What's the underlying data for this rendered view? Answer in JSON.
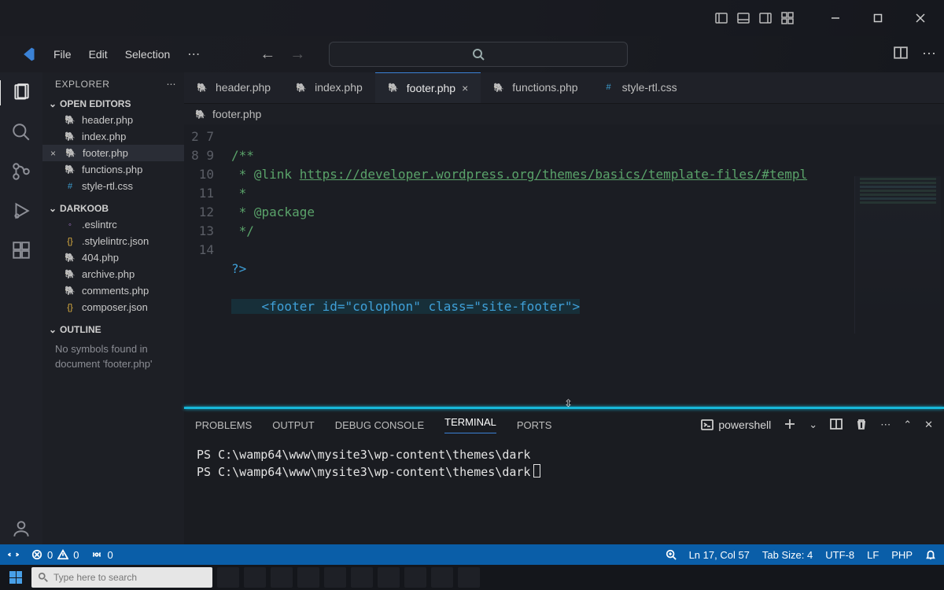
{
  "menu": {
    "file": "File",
    "edit": "Edit",
    "selection": "Selection"
  },
  "sidebar": {
    "title": "EXPLORER",
    "sections": {
      "openEditors": "OPEN EDITORS",
      "project": "DARKOOB",
      "outline": "OUTLINE"
    },
    "openEditors": [
      {
        "name": "header.php",
        "icon": "php"
      },
      {
        "name": "index.php",
        "icon": "php"
      },
      {
        "name": "footer.php",
        "icon": "php",
        "active": true
      },
      {
        "name": "functions.php",
        "icon": "php"
      },
      {
        "name": "style-rtl.css",
        "icon": "css"
      }
    ],
    "projectFiles": [
      {
        "name": ".eslintrc",
        "icon": "rc"
      },
      {
        "name": ".stylelintrc.json",
        "icon": "json"
      },
      {
        "name": "404.php",
        "icon": "php"
      },
      {
        "name": "archive.php",
        "icon": "php"
      },
      {
        "name": "comments.php",
        "icon": "php"
      },
      {
        "name": "composer.json",
        "icon": "json"
      }
    ],
    "outlineMsg": "No symbols found in document 'footer.php'"
  },
  "tabs": [
    {
      "name": "header.php",
      "icon": "php"
    },
    {
      "name": "index.php",
      "icon": "php"
    },
    {
      "name": "footer.php",
      "icon": "php",
      "active": true
    },
    {
      "name": "functions.php",
      "icon": "php"
    },
    {
      "name": "style-rtl.css",
      "icon": "css"
    }
  ],
  "breadcrumb": "footer.php",
  "gutter": [
    "2",
    "7",
    "8",
    "9",
    "10",
    "11",
    "12",
    "13",
    "14"
  ],
  "code": {
    "l0": "/**",
    "l1a": " * @link ",
    "l1b": "https://developer.wordpress.org/themes/basics/template-files/#templ",
    "l2": " *",
    "l3": " * @package",
    "l4": " */",
    "l5": "",
    "l6": "?>",
    "l7": "",
    "l8": "    <footer id=\"colophon\" class=\"site-footer\">"
  },
  "panel": {
    "tabs": {
      "problems": "PROBLEMS",
      "output": "OUTPUT",
      "debug": "DEBUG CONSOLE",
      "terminal": "TERMINAL",
      "ports": "PORTS"
    },
    "shell": "powershell",
    "lines": [
      "PS C:\\wamp64\\www\\mysite3\\wp-content\\themes\\dark",
      "PS C:\\wamp64\\www\\mysite3\\wp-content\\themes\\dark"
    ]
  },
  "status": {
    "errors": "0",
    "warnings": "0",
    "radio": "0",
    "pos": "Ln 17, Col 57",
    "spaces": "Tab Size: 4",
    "enc": "UTF-8",
    "eol": "LF",
    "lang": "PHP"
  },
  "taskbar": {
    "search": "Type here to search"
  }
}
